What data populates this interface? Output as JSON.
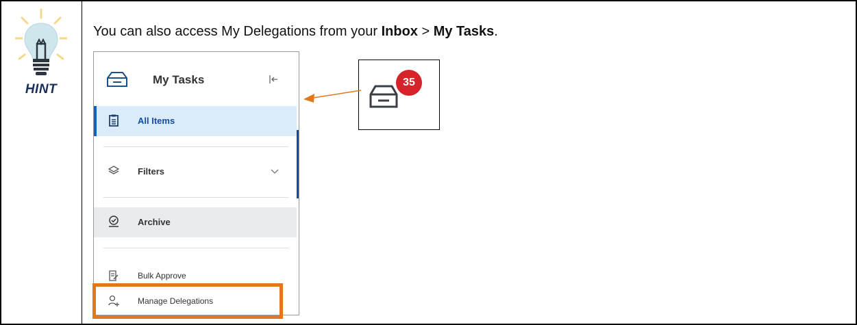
{
  "hint": {
    "label": "HINT",
    "icon": "lightbulb-icon"
  },
  "instruction": {
    "prefix": "You can also access My Delegations from your ",
    "inbox": "Inbox",
    "separator": " > ",
    "my_tasks": "My Tasks",
    "suffix": "."
  },
  "panel": {
    "title": "My Tasks",
    "items": [
      {
        "label": "All Items",
        "icon": "clipboard-icon",
        "selected": true
      },
      {
        "label": "Filters",
        "icon": "layers-icon"
      },
      {
        "label": "Archive",
        "icon": "archive-check-icon"
      },
      {
        "label": "Bulk Approve",
        "icon": "bulk-approve-icon"
      },
      {
        "label": "Manage Delegations",
        "icon": "user-add-icon",
        "highlighted": true
      }
    ]
  },
  "inbox_badge": {
    "count": "35",
    "icon": "inbox-tray-icon"
  },
  "colors": {
    "accent": "#0b63c6",
    "selected_bg": "#dcebfa",
    "highlight": "#e07820",
    "badge": "#d6232a",
    "arrow": "#e07820"
  }
}
